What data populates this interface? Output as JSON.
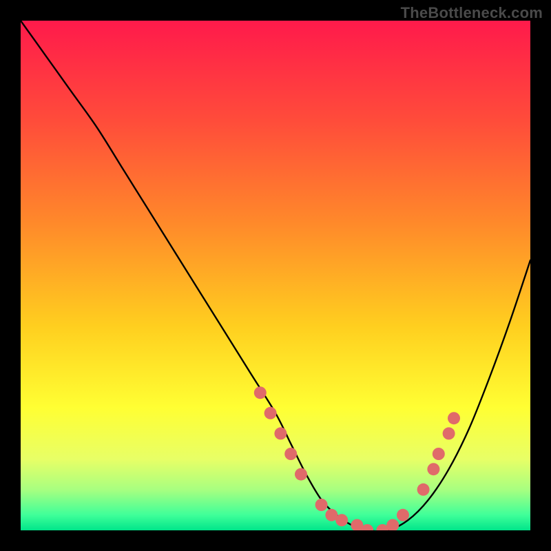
{
  "watermark": "TheBottleneck.com",
  "chart_data": {
    "type": "line",
    "title": "",
    "xlabel": "",
    "ylabel": "",
    "xlim": [
      0,
      100
    ],
    "ylim": [
      0,
      100
    ],
    "grid": false,
    "legend": false,
    "gradient_stops": [
      {
        "offset": 0.0,
        "color": "#ff1a4b"
      },
      {
        "offset": 0.2,
        "color": "#ff4d3a"
      },
      {
        "offset": 0.4,
        "color": "#ff8a2a"
      },
      {
        "offset": 0.6,
        "color": "#ffcf1f"
      },
      {
        "offset": 0.76,
        "color": "#ffff33"
      },
      {
        "offset": 0.86,
        "color": "#e8ff66"
      },
      {
        "offset": 0.92,
        "color": "#a8ff80"
      },
      {
        "offset": 0.97,
        "color": "#3fff99"
      },
      {
        "offset": 1.0,
        "color": "#00e58a"
      }
    ],
    "series": [
      {
        "name": "bottleneck-curve",
        "x": [
          0,
          5,
          10,
          15,
          20,
          25,
          30,
          35,
          40,
          45,
          50,
          53,
          56,
          59,
          62,
          65,
          68,
          72,
          76,
          80,
          84,
          88,
          92,
          96,
          100
        ],
        "y": [
          100,
          93,
          86,
          79,
          71,
          63,
          55,
          47,
          39,
          31,
          23,
          17,
          11,
          6,
          3,
          1,
          0,
          0,
          2,
          6,
          12,
          20,
          30,
          41,
          53
        ]
      }
    ],
    "markers": {
      "name": "highlighted-points",
      "color": "#e06a6a",
      "radius_px": 9,
      "points": [
        {
          "x": 47,
          "y": 27
        },
        {
          "x": 49,
          "y": 23
        },
        {
          "x": 51,
          "y": 19
        },
        {
          "x": 53,
          "y": 15
        },
        {
          "x": 55,
          "y": 11
        },
        {
          "x": 59,
          "y": 5
        },
        {
          "x": 61,
          "y": 3
        },
        {
          "x": 63,
          "y": 2
        },
        {
          "x": 66,
          "y": 1
        },
        {
          "x": 68,
          "y": 0
        },
        {
          "x": 71,
          "y": 0
        },
        {
          "x": 73,
          "y": 1
        },
        {
          "x": 75,
          "y": 3
        },
        {
          "x": 79,
          "y": 8
        },
        {
          "x": 81,
          "y": 12
        },
        {
          "x": 82,
          "y": 15
        },
        {
          "x": 84,
          "y": 19
        },
        {
          "x": 85,
          "y": 22
        }
      ]
    }
  }
}
